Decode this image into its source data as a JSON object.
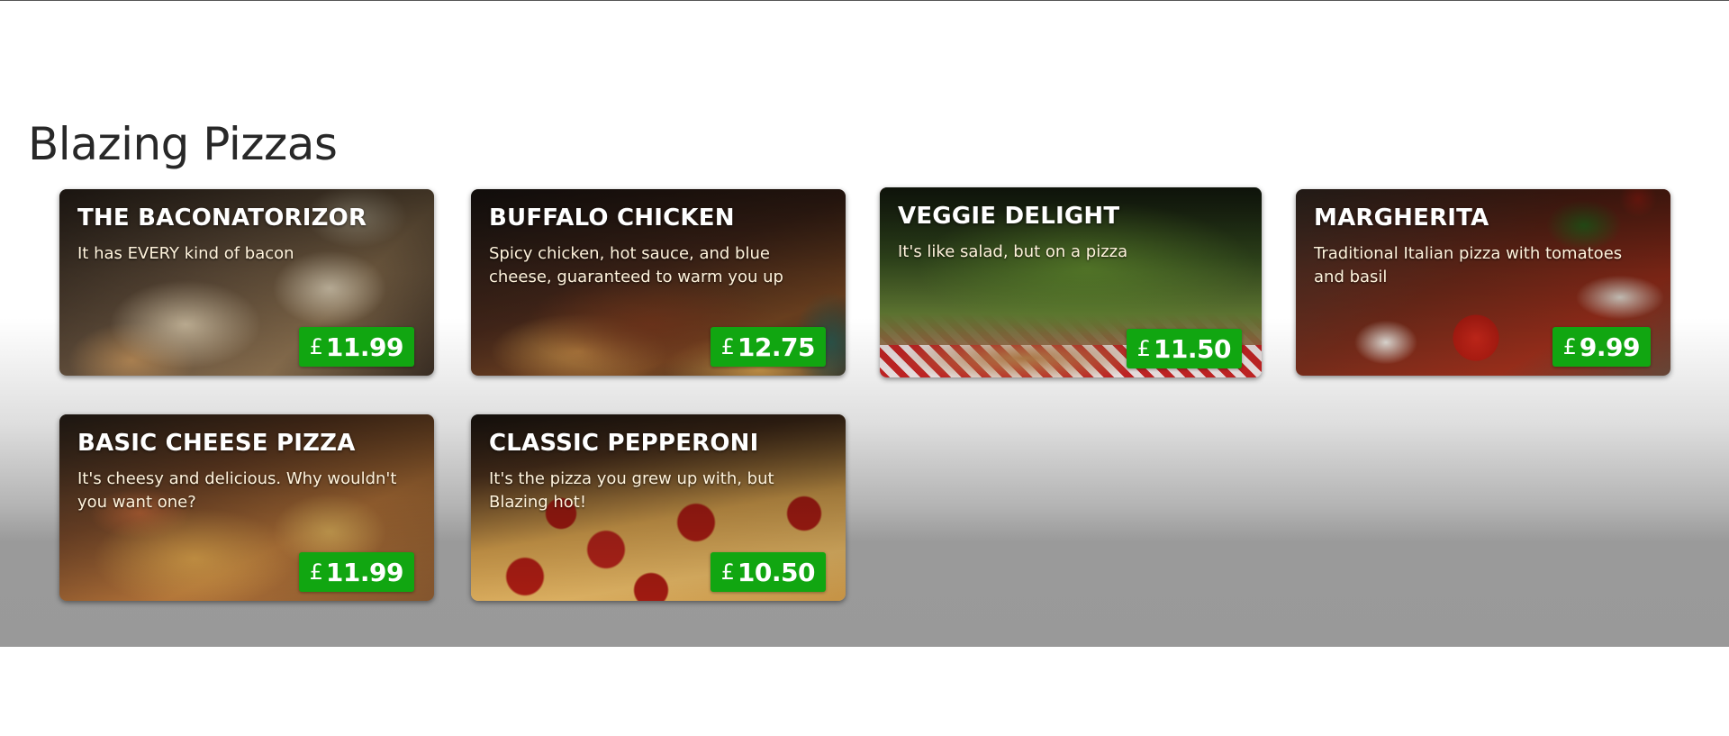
{
  "page": {
    "title": "Blazing Pizzas"
  },
  "currency_symbol": "£",
  "specials": [
    {
      "name": "THE BACONATORIZOR",
      "description": "It has EVERY kind of bacon",
      "price": "11.99",
      "image": "bacon-pizza-photo"
    },
    {
      "name": "BUFFALO CHICKEN",
      "description": "Spicy chicken, hot sauce, and blue cheese, guaranteed to warm you up",
      "price": "12.75",
      "image": "buffalo-chicken-pizza-photo"
    },
    {
      "name": "VEGGIE DELIGHT",
      "description": "It's like salad, but on a pizza",
      "price": "11.50",
      "image": "veggie-pizza-photo"
    },
    {
      "name": "MARGHERITA",
      "description": "Traditional Italian pizza with tomatoes and basil",
      "price": "9.99",
      "image": "margherita-pizza-photo"
    },
    {
      "name": "BASIC CHEESE PIZZA",
      "description": "It's cheesy and delicious. Why wouldn't you want one?",
      "price": "11.99",
      "image": "cheese-pizza-photo"
    },
    {
      "name": "CLASSIC PEPPERONI",
      "description": "It's the pizza you grew up with, but Blazing hot!",
      "price": "10.50",
      "image": "pepperoni-pizza-photo"
    }
  ],
  "colors": {
    "price_badge": "#11a611",
    "title_text": "#282828"
  }
}
